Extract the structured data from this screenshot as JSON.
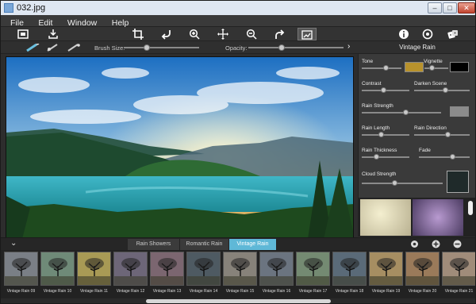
{
  "window": {
    "title": "032.jpg",
    "min_icon": "minimize-icon",
    "max_icon": "maximize-icon",
    "close_icon": "close-icon"
  },
  "menu": [
    "File",
    "Edit",
    "Window",
    "Help"
  ],
  "toolbar": {
    "left_icons": [
      "fit-screen-icon",
      "save-icon"
    ],
    "center_icons": [
      "crop-icon",
      "undo-icon",
      "zoom-in-icon",
      "move-icon",
      "zoom-out-icon",
      "redo-icon",
      "actual-size-icon"
    ],
    "right_icons": [
      "info-icon",
      "settings-icon",
      "dice-icon"
    ]
  },
  "brush": {
    "label": "Brush Size:",
    "value_pct": 30,
    "opacity_label": "Opacity:",
    "opacity_pct": 35
  },
  "panel": {
    "title": "Vintage Rain",
    "tone_label": "Tone",
    "tone_color": "#b8922c",
    "vignette_label": "Vignette",
    "vignette_color": "#000000",
    "contrast_label": "Contrast",
    "darken_label": "Darken Scene",
    "rain_strength_label": "Rain Strength",
    "rain_strength_color": "#8b8b8b",
    "rain_length_label": "Rain Length",
    "rain_direction_label": "Rain Direction",
    "rain_thickness_label": "Rain Thickness",
    "fade_label": "Fade",
    "cloud_strength_label": "Cloud Strength",
    "values": {
      "tone": 0.6,
      "vignette": 0.3,
      "contrast": 0.45,
      "darken": 0.55,
      "rain_strength": 0.55,
      "rain_length": 0.4,
      "rain_direction": 0.6,
      "rain_thickness": 0.3,
      "fade": 0.65,
      "cloud_strength": 0.4
    }
  },
  "tabs": {
    "collapse_icon": "chevron-down-icon",
    "items": [
      "Rain Showers",
      "Romantic Rain",
      "Vintage Rain"
    ],
    "active": 2,
    "right_icons": [
      "settings-icon",
      "plus-icon",
      "minus-icon"
    ]
  },
  "thumbnails": [
    "Vintage Rain 09",
    "Vintage Rain 10",
    "Vintage Rain 11",
    "Vintage Rain 12",
    "Vintage Rain 13",
    "Vintage Rain 14",
    "Vintage Rain 15",
    "Vintage Rain 16",
    "Vintage Rain 17",
    "Vintage Rain 18",
    "Vintage Rain 19",
    "Vintage Rain 20",
    "Vintage Rain 21"
  ],
  "thumb_tints": [
    "#7a7f86",
    "#6f8a78",
    "#a89a55",
    "#6d6678",
    "#7b6670",
    "#4e5a62",
    "#87827a",
    "#6b7480",
    "#748a72",
    "#5a6a78",
    "#a68e62",
    "#9a7a5a",
    "#a08c7a"
  ]
}
